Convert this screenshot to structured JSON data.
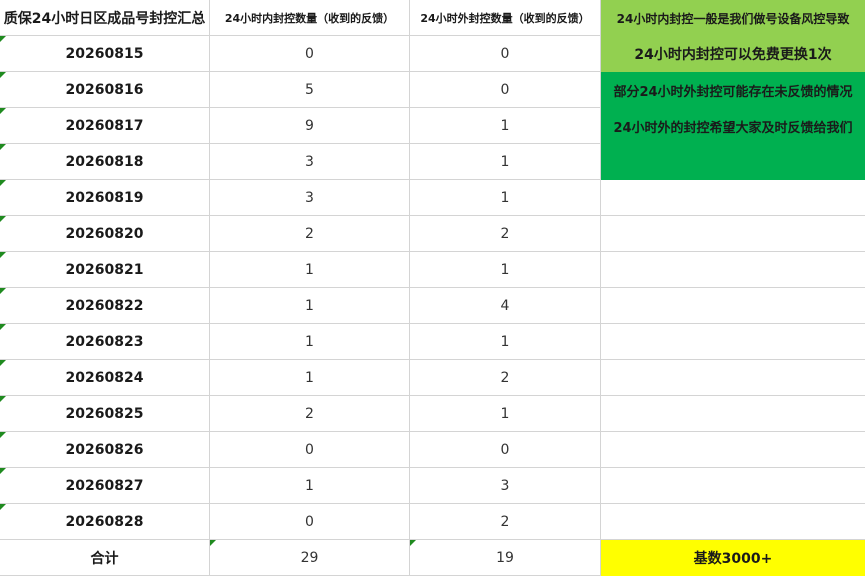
{
  "header": {
    "title": "质保24小时日区成品号封控汇总",
    "col_within": "24小时内封控数量（收到的反馈）",
    "col_outside": "24小时外封控数量（收到的反馈）"
  },
  "rows": [
    {
      "date": "20260815",
      "within": "0",
      "outside": "0"
    },
    {
      "date": "20260816",
      "within": "5",
      "outside": "0"
    },
    {
      "date": "20260817",
      "within": "9",
      "outside": "1"
    },
    {
      "date": "20260818",
      "within": "3",
      "outside": "1"
    },
    {
      "date": "20260819",
      "within": "3",
      "outside": "1"
    },
    {
      "date": "20260820",
      "within": "2",
      "outside": "2"
    },
    {
      "date": "20260821",
      "within": "1",
      "outside": "1"
    },
    {
      "date": "20260822",
      "within": "1",
      "outside": "4"
    },
    {
      "date": "20260823",
      "within": "1",
      "outside": "1"
    },
    {
      "date": "20260824",
      "within": "1",
      "outside": "2"
    },
    {
      "date": "20260825",
      "within": "2",
      "outside": "1"
    },
    {
      "date": "20260826",
      "within": "0",
      "outside": "0"
    },
    {
      "date": "20260827",
      "within": "1",
      "outside": "3"
    },
    {
      "date": "20260828",
      "within": "0",
      "outside": "2"
    }
  ],
  "total": {
    "label": "合计",
    "within": "29",
    "outside": "19"
  },
  "notes": {
    "line1": "24小时内封控一般是我们做号设备风控导致",
    "line2": "24小时内封控可以免费更换1次",
    "line3": "部分24小时外封控可能存在未反馈的情况",
    "line4": "24小时外的封控希望大家及时反馈给我们",
    "base": "基数3000+"
  },
  "colors": {
    "note_light_green": "#92d050",
    "note_green": "#00b050",
    "highlight_yellow": "#ffff00",
    "error_triangle": "#1f8a1f"
  }
}
